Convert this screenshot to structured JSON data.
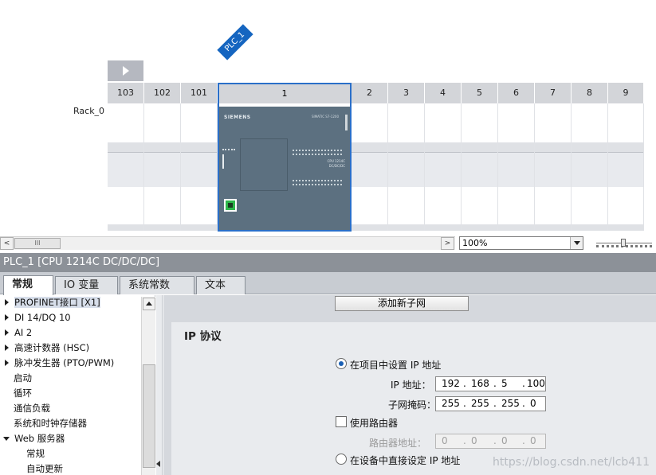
{
  "device_view": {
    "device_tag": "PLC_1",
    "rack_label": "Rack_0",
    "slots": [
      "103",
      "102",
      "101",
      "1",
      "2",
      "3",
      "4",
      "5",
      "6",
      "7",
      "8",
      "9"
    ],
    "cpu_brand": "SIEMENS",
    "cpu_model": "SIMATIC S7-1200",
    "cpu_label_line1": "CPU 1214C",
    "cpu_label_line2": "DC/DC/DC"
  },
  "scrollbar": {
    "thumb_label": "III",
    "left_arrow": "<",
    "right_arrow": ">"
  },
  "zoom": {
    "value": "100%"
  },
  "inspector": {
    "title": "PLC_1 [CPU 1214C DC/DC/DC]",
    "tabs": [
      "常规",
      "IO 变量",
      "系统常数",
      "文本"
    ]
  },
  "tree": {
    "items": [
      {
        "label": "PROFINET接口 [X1]",
        "expander": "collapsed",
        "selected": true
      },
      {
        "label": "DI 14/DQ 10",
        "expander": "collapsed"
      },
      {
        "label": "AI 2",
        "expander": "collapsed"
      },
      {
        "label": "高速计数器 (HSC)",
        "expander": "collapsed"
      },
      {
        "label": "脉冲发生器 (PTO/PWM)",
        "expander": "collapsed"
      },
      {
        "label": "启动",
        "expander": "none"
      },
      {
        "label": "循环",
        "expander": "none"
      },
      {
        "label": "通信负载",
        "expander": "none"
      },
      {
        "label": "系统和时钟存储器",
        "expander": "none"
      },
      {
        "label": "Web 服务器",
        "expander": "expanded"
      },
      {
        "label": "常规",
        "expander": "child"
      },
      {
        "label": "自动更新",
        "expander": "child"
      }
    ]
  },
  "content": {
    "add_subnet_button": "添加新子网",
    "section_title": "IP 协议",
    "radio_set_in_project": "在项目中设置 IP 地址",
    "ip_label": "IP 地址：",
    "ip_octets": [
      "192",
      "168",
      "5",
      "100"
    ],
    "mask_label": "子网掩码：",
    "mask_octets": [
      "255",
      "255",
      "255",
      "0"
    ],
    "use_router_label": "使用路由器",
    "router_label": "路由器地址：",
    "router_octets": [
      "0",
      "0",
      "0",
      "0"
    ],
    "radio_set_on_device": "在设备中直接设定 IP 地址",
    "set_in_project_selected": true,
    "use_router_checked": false
  },
  "watermark": "https://blog.csdn.net/lcb411"
}
